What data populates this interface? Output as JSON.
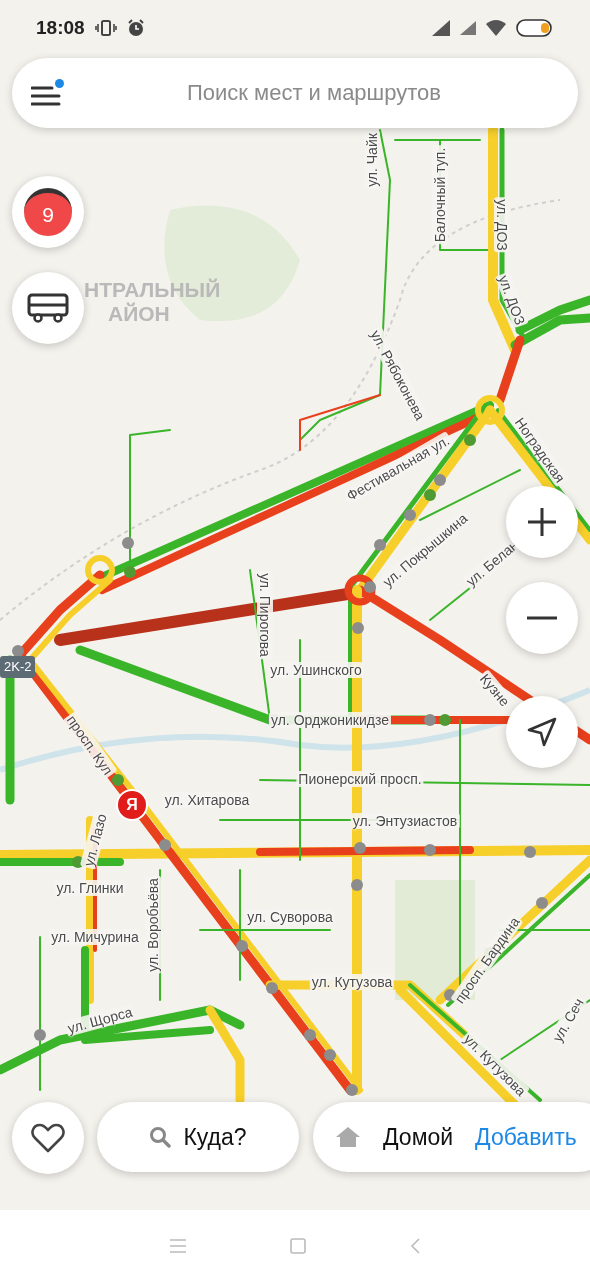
{
  "status_bar": {
    "time": "18:08"
  },
  "search": {
    "placeholder": "Поиск мест и маршрутов",
    "menu_notification": true
  },
  "traffic_score": {
    "value": "9"
  },
  "map": {
    "district_label": [
      "НТРАЛЬНЫЙ",
      "АЙОН"
    ],
    "route_shield": "2K-2",
    "location_pin": "Я",
    "labels": [
      {
        "text": "ул. Чайк"
      },
      {
        "text": "Балочный туп."
      },
      {
        "text": "ул. ДОЗ"
      },
      {
        "text": "ул. ДОЗ"
      },
      {
        "text": "ул. Рябоконева"
      },
      {
        "text": "Фестивальная ул."
      },
      {
        "text": "ул. Покрышкина"
      },
      {
        "text": "ул. Белан"
      },
      {
        "text": "Ноградская"
      },
      {
        "text": "ул. Пирогова"
      },
      {
        "text": "ул. Ушинского"
      },
      {
        "text": "ул. Орджоникидзе"
      },
      {
        "text": "Кузне"
      },
      {
        "text": "просп. Кул"
      },
      {
        "text": "Пионерский просп."
      },
      {
        "text": "ул. Хитарова"
      },
      {
        "text": "ул. Энтузиастов"
      },
      {
        "text": "ул. Лазо"
      },
      {
        "text": "ул. Глинки"
      },
      {
        "text": "ул. Воробьёва"
      },
      {
        "text": "ул. Суворова"
      },
      {
        "text": "ул. Мичурина"
      },
      {
        "text": "ул. Кутузова"
      },
      {
        "text": "просп. Бардина"
      },
      {
        "text": "ул. Щорса"
      },
      {
        "text": "ул. Кутузова"
      },
      {
        "text": "ул. Сеч"
      }
    ]
  },
  "bottom_bar": {
    "where": "Куда?",
    "home": "Домой",
    "add": "Добавить"
  }
}
